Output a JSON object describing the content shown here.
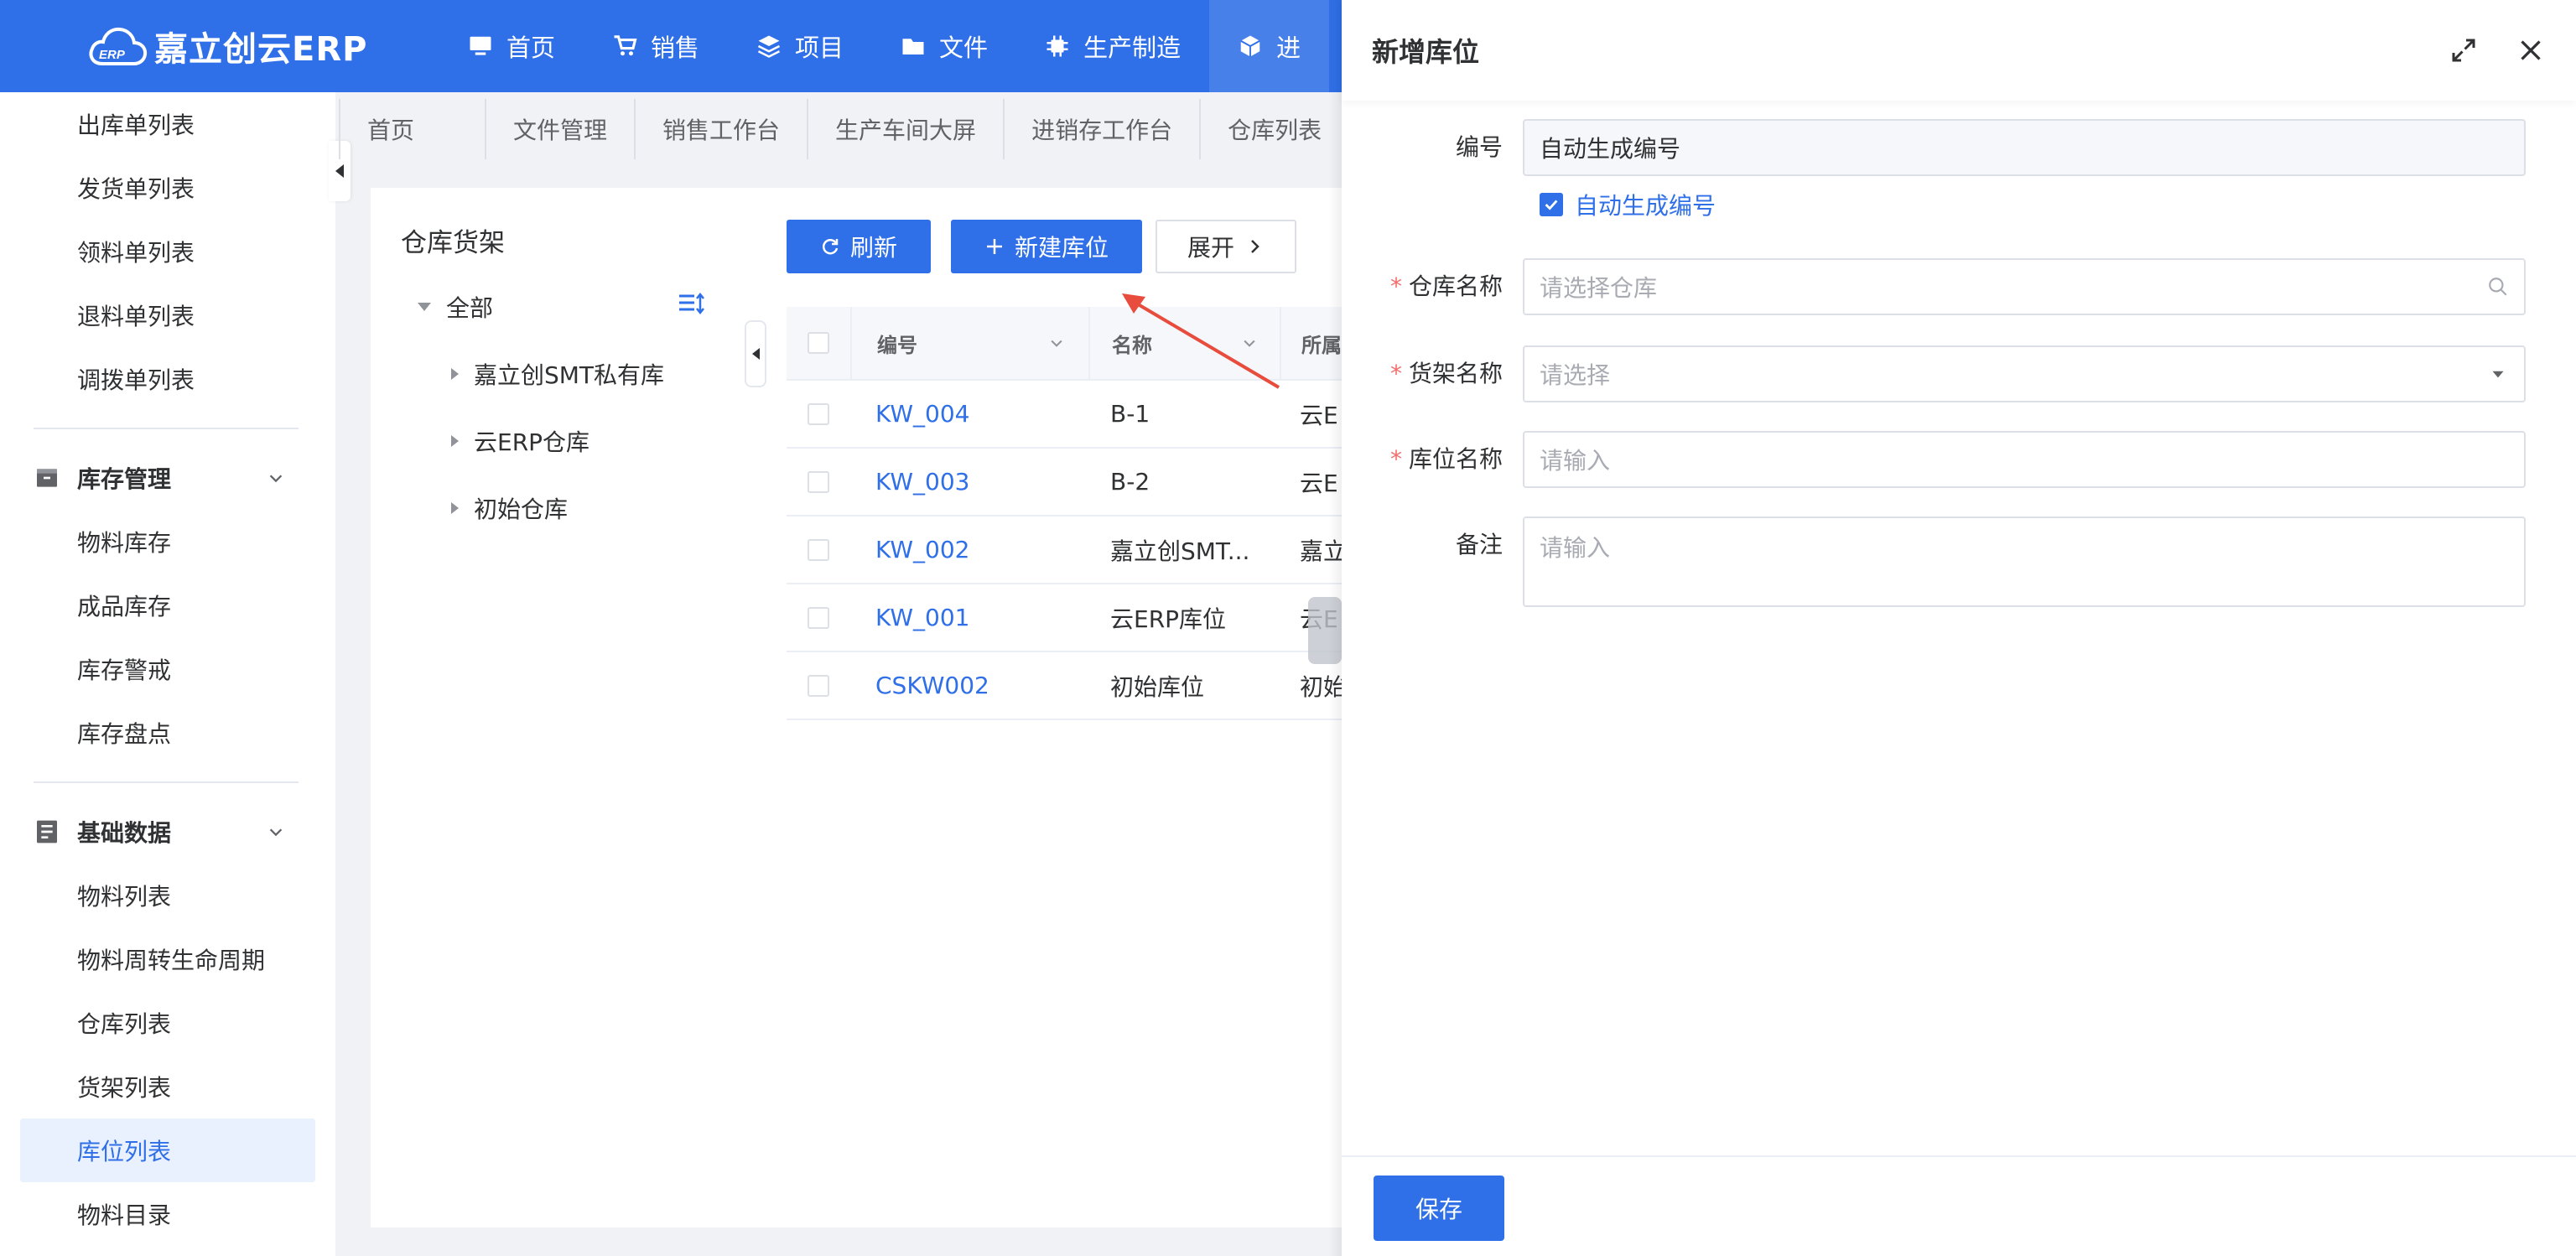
{
  "app": {
    "logo_text": "嘉立创云ERP",
    "logo_badge": "ERP"
  },
  "nav": [
    {
      "label": "首页",
      "icon": "monitor-icon"
    },
    {
      "label": "销售",
      "icon": "cart-icon"
    },
    {
      "label": "项目",
      "icon": "layers-icon"
    },
    {
      "label": "文件",
      "icon": "folder-icon"
    },
    {
      "label": "生产制造",
      "icon": "chip-icon"
    },
    {
      "label": "进",
      "icon": "box-icon"
    }
  ],
  "sidebar": {
    "top_items": [
      "出库单列表",
      "发货单列表",
      "领料单列表",
      "退料单列表",
      "调拨单列表"
    ],
    "groups": [
      {
        "label": "库存管理",
        "items": [
          "物料库存",
          "成品库存",
          "库存警戒",
          "库存盘点"
        ]
      },
      {
        "label": "基础数据",
        "items": [
          "物料列表",
          "物料周转生命周期",
          "仓库列表",
          "货架列表",
          "库位列表",
          "物料目录"
        ]
      }
    ],
    "active_item": "库位列表"
  },
  "tabs": [
    "首页",
    "文件管理",
    "销售工作台",
    "生产车间大屏",
    "进销存工作台",
    "仓库列表"
  ],
  "tree": {
    "title": "仓库货架",
    "root": "全部",
    "children": [
      "嘉立创SMT私有库",
      "云ERP仓库",
      "初始仓库"
    ]
  },
  "toolbar": {
    "refresh": "刷新",
    "create": "新建库位",
    "expand": "展开"
  },
  "table": {
    "headers": [
      "编号",
      "名称",
      "所属"
    ],
    "rows": [
      {
        "code": "KW_004",
        "name": "B-1",
        "extra": "云E"
      },
      {
        "code": "KW_003",
        "name": "B-2",
        "extra": "云E"
      },
      {
        "code": "KW_002",
        "name": "嘉立创SMT...",
        "extra": "嘉立"
      },
      {
        "code": "KW_001",
        "name": "云ERP库位",
        "extra": "云E"
      },
      {
        "code": "CSKW002",
        "name": "初始库位",
        "extra": "初始"
      }
    ]
  },
  "drawer": {
    "title": "新增库位",
    "fields": {
      "code_label": "编号",
      "code_value": "自动生成编号",
      "auto_checkbox": "自动生成编号",
      "warehouse_label": "仓库名称",
      "warehouse_placeholder": "请选择仓库",
      "shelf_label": "货架名称",
      "shelf_placeholder": "请选择",
      "location_label": "库位名称",
      "location_placeholder": "请输入",
      "remark_label": "备注",
      "remark_placeholder": "请输入"
    },
    "save": "保存"
  },
  "colors": {
    "primary": "#2f6fe8",
    "required": "#f56c6c",
    "annotation_arrow": "#e74c3c"
  }
}
